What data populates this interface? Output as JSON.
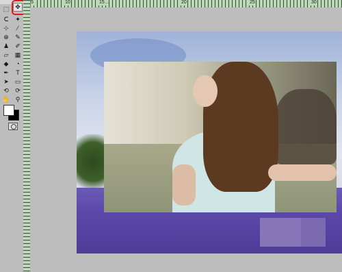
{
  "document_tab": "...",
  "ruler_labels": [
    "5",
    "10",
    "15",
    "20",
    "25",
    "30"
  ],
  "tools": [
    {
      "name": "marquee-tool-icon",
      "glyph": "⬚"
    },
    {
      "name": "move-tool-icon",
      "glyph": "✥"
    },
    {
      "name": "lasso-tool-icon",
      "glyph": "ᑕ"
    },
    {
      "name": "magic-wand-tool-icon",
      "glyph": "✦"
    },
    {
      "name": "crop-tool-icon",
      "glyph": "⊹"
    },
    {
      "name": "eyedropper-tool-icon",
      "glyph": "⁄"
    },
    {
      "name": "healing-brush-tool-icon",
      "glyph": "⊕"
    },
    {
      "name": "brush-tool-icon",
      "glyph": "✎"
    },
    {
      "name": "stamp-tool-icon",
      "glyph": "♟"
    },
    {
      "name": "history-brush-tool-icon",
      "glyph": "✐"
    },
    {
      "name": "eraser-tool-icon",
      "glyph": "▱"
    },
    {
      "name": "gradient-tool-icon",
      "glyph": "▦"
    },
    {
      "name": "blur-tool-icon",
      "glyph": "◆"
    },
    {
      "name": "dodge-tool-icon",
      "glyph": "◔"
    },
    {
      "name": "pen-tool-icon",
      "glyph": "✒"
    },
    {
      "name": "type-tool-icon",
      "glyph": "T"
    },
    {
      "name": "path-select-tool-icon",
      "glyph": "➤"
    },
    {
      "name": "shape-tool-icon",
      "glyph": "▭"
    },
    {
      "name": "3d-rotate-tool-icon",
      "glyph": "⟲"
    },
    {
      "name": "3d-orbit-tool-icon",
      "glyph": "⟳"
    },
    {
      "name": "hand-tool-icon",
      "glyph": "✋"
    },
    {
      "name": "zoom-tool-icon",
      "glyph": "⚲"
    }
  ],
  "selected_tool": "move-tool-icon",
  "colors": {
    "foreground": "#ffffff",
    "background": "#000000",
    "highlight": "#e21a1a",
    "ruler": "#bcd8b9"
  }
}
